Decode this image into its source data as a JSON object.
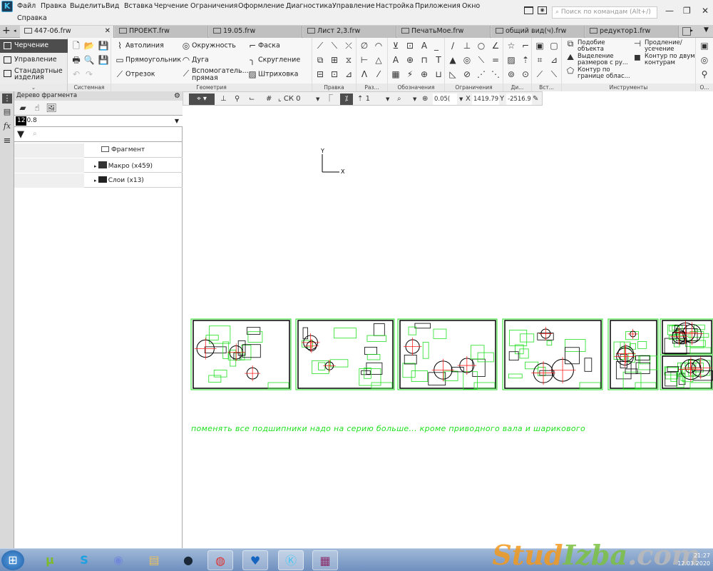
{
  "menu": [
    "Файл",
    "Правка",
    "Выделить",
    "Вид",
    "Вставка",
    "Черчение",
    "Ограничения",
    "Оформление",
    "Диагностика",
    "Управление",
    "Настройка",
    "Приложения",
    "Окно",
    "Справка"
  ],
  "search_placeholder": "Поиск по командам (Alt+/)",
  "tabs": [
    {
      "label": "447-06.frw",
      "active": true
    },
    {
      "label": "ПРОЕКТ.frw"
    },
    {
      "label": "19.05.frw"
    },
    {
      "label": "Лист 2,3.frw"
    },
    {
      "label": "ПечатьМое.frw"
    },
    {
      "label": "общий вид(ч).frw"
    },
    {
      "label": "редуктор1.frw"
    }
  ],
  "modes": [
    {
      "label": "Черчение",
      "selected": true
    },
    {
      "label": "Управление"
    },
    {
      "label": "Стандартные изделия"
    }
  ],
  "groups": {
    "system": "Системная",
    "geometry": "Геометрия",
    "edit": "Правка",
    "dims": "Раз...",
    "notation": "Обозначения",
    "constraints": "Ограничения",
    "diag": "Ди...",
    "insert": "Вст...",
    "tools": "Инструменты",
    "other": "О..."
  },
  "geometry_buttons": [
    "Автолиния",
    "Окружность",
    "Фаска",
    "Прямоугольник",
    "Дуга",
    "Скругление",
    "Отрезок",
    "Вспомогатель... прямая",
    "Штриховка"
  ],
  "tools_buttons": [
    "Подобие объекта",
    "Продление/ усечение",
    "Выделение размеров с ру...",
    "Контур по двум контурам",
    "Контур по границе облас..."
  ],
  "tree": {
    "title": "Дерево фрагмента",
    "layer_num": "12",
    "layer_value": "0.8",
    "root": "Фрагмент",
    "items": [
      "Макро (x459)",
      "Слои (x13)"
    ]
  },
  "toolbar": {
    "cs": "СК 0",
    "step": "1",
    "zoom": "0.05(",
    "x_label": "X",
    "x_value": "1419.79",
    "y_label": "Y",
    "y_value": "-2516.9"
  },
  "canvas": {
    "axis_x": "X",
    "axis_y": "Y",
    "note": "поменять все подшипники надо на серию больше... кроме приводного вала и шарикового"
  },
  "taskbar": {
    "apps": [
      "start",
      "utorrent",
      "skype",
      "discord",
      "explorer",
      "steam",
      "chrome",
      "heart-app",
      "kompas",
      "winrar"
    ],
    "time": "21:27",
    "date": "12.03.2020"
  },
  "watermark": {
    "part1": "Stud",
    "part2": "Izba",
    ".com": ".com"
  },
  "colors": {
    "accent_dark": "#4d4d4d",
    "drawing_green": "#22e022",
    "drawing_red": "#ff2020"
  }
}
